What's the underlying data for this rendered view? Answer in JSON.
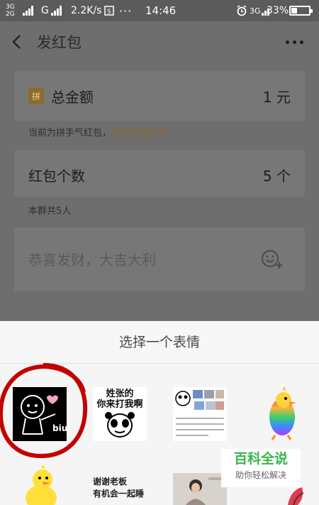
{
  "status_bar": {
    "net_top": "3G",
    "net_bottom": "2G",
    "carrier": "G",
    "speed": "2.2K/s",
    "time": "14:46",
    "net_right": "3G",
    "battery": "33%"
  },
  "nav": {
    "title": "发红包"
  },
  "amount_row": {
    "badge": "拼",
    "label": "总金额",
    "value": "1 元"
  },
  "amount_hint": {
    "prefix": "当前为拼手气红包，",
    "link": "改为普通红包"
  },
  "count_row": {
    "label": "红包个数",
    "value": "5 个"
  },
  "count_hint": "本群共5人",
  "greeting": {
    "placeholder": "恭喜发财，大吉大利"
  },
  "sheet": {
    "title": "选择一个表情"
  },
  "stickers": {
    "s2_line1": "姓张的",
    "s2_line2": "你来打我啊",
    "s6_line1": "谢谢老板",
    "s6_line2": "有机会一起睡"
  },
  "watermark": {
    "title": "百科全说",
    "subtitle": "助你轻松解决"
  },
  "colors": {
    "overlay_bg": "#6e6e6e",
    "link": "#8a6b35",
    "watermark_green": "#39b54a",
    "highlight_red": "#c40000"
  }
}
